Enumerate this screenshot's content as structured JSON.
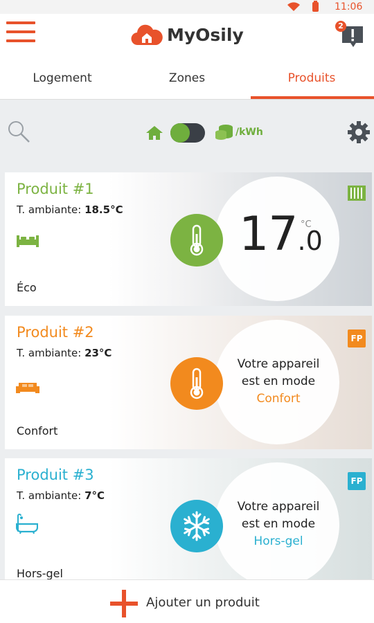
{
  "status_bar": {
    "time": "11:06"
  },
  "app": {
    "brand": "MyOsily",
    "notification_count": "2"
  },
  "tabs": [
    {
      "label": "Logement",
      "active": false
    },
    {
      "label": "Zones",
      "active": false
    },
    {
      "label": "Produits",
      "active": true
    }
  ],
  "toolbar": {
    "unit_label": "/kWh",
    "toggle_state": "on"
  },
  "products": [
    {
      "name": "Produit #1",
      "ambient_label": "T. ambiante:",
      "ambient_value": "18.5°C",
      "room_icon": "bed-icon",
      "mode": "Éco",
      "setpoint_int": "17",
      "setpoint_dec": ".0",
      "setpoint_unit": "°C",
      "mode_icon": "thermometer-icon",
      "color": "#7cb342"
    },
    {
      "name": "Produit #2",
      "ambient_label": "T. ambiante:",
      "ambient_value": "23°C",
      "room_icon": "sofa-icon",
      "mode": "Confort",
      "message_line1": "Votre appareil",
      "message_line2": "est en mode",
      "message_mode": "Confort",
      "badge": "FP",
      "mode_icon": "thermometer-icon",
      "color": "#f28a1e"
    },
    {
      "name": "Produit #3",
      "ambient_label": "T. ambiante:",
      "ambient_value": "7°C",
      "room_icon": "bathtub-icon",
      "mode": "Hors-gel",
      "message_line1": "Votre appareil",
      "message_line2": "est en mode",
      "message_mode": "Hors-gel",
      "badge": "FP",
      "mode_icon": "snowflake-icon",
      "color": "#2ab0d0"
    }
  ],
  "bottom_bar": {
    "add_label": "Ajouter un produit"
  },
  "colors": {
    "accent": "#e8522b",
    "eco": "#7cb342",
    "confort": "#f28a1e",
    "horsgel": "#2ab0d0",
    "dark": "#3a3f46"
  }
}
